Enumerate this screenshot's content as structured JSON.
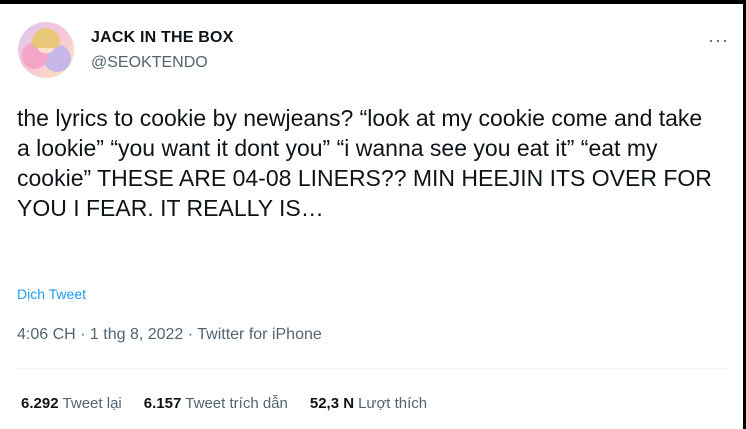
{
  "author": {
    "name": "JACK IN THE BOX",
    "handle": "@SEOKTENDO",
    "avatar_icon": "avatar-image"
  },
  "menu": {
    "more_label": "···"
  },
  "tweet": {
    "text": "the lyrics to cookie by newjeans? “look at my cookie come and take a lookie” “you want it dont you” “i wanna see you eat it” “eat my cookie” THESE ARE 04-08 LINERS?? MIN HEEJIN ITS OVER FOR YOU I FEAR. IT REALLY IS…",
    "translate_label": "Dịch Tweet",
    "timestamp": "4:06 CH · 1 thg 8, 2022 · Twitter for iPhone"
  },
  "stats": [
    {
      "count": "6.292",
      "label": "Tweet lại"
    },
    {
      "count": "6.157",
      "label": "Tweet trích dẫn"
    },
    {
      "count": "52,3 N",
      "label": "Lượt thích"
    }
  ],
  "colors": {
    "link": "#1d9bf0",
    "secondary_text": "#536471",
    "primary_text": "#0f1419"
  }
}
